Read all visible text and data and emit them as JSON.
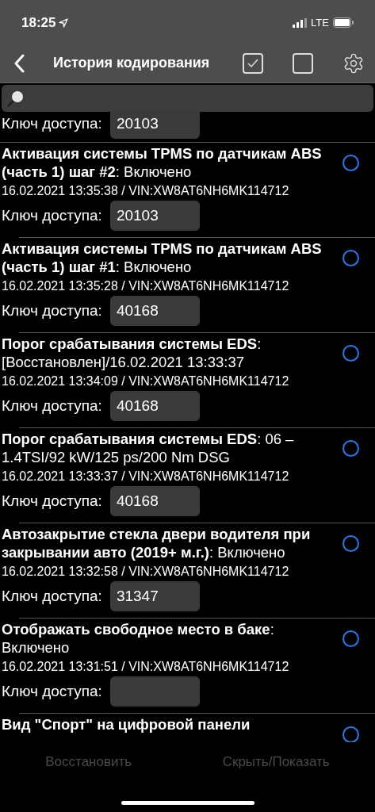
{
  "status_bar": {
    "time": "18:25",
    "network": "LTE"
  },
  "nav": {
    "title": "История кодирования"
  },
  "entries": [
    {
      "kind": "key_only",
      "key_label": "Ключ доступа:",
      "key": "20103"
    },
    {
      "kind": "full",
      "title": "**Активация системы TPMS по датчикам ABS (часть 1) шаг #2**: Включено",
      "meta": "16.02.2021 13:35:38 / VIN:XW8AT6NH6MK114712",
      "key_label": "Ключ доступа:",
      "key": "20103",
      "selected": false
    },
    {
      "kind": "full",
      "title": "**Активация системы TPMS по датчикам ABS (часть 1) шаг #1**: Включено",
      "meta": "16.02.2021 13:35:28 / VIN:XW8AT6NH6MK114712",
      "key_label": "Ключ доступа:",
      "key": "40168",
      "selected": false
    },
    {
      "kind": "full",
      "title": "**Порог срабатывания системы EDS**: [Восстановлен]/16.02.2021 13:33:37",
      "meta": "16.02.2021 13:34:09 / VIN:XW8AT6NH6MK114712",
      "key_label": "Ключ доступа:",
      "key": "40168",
      "selected": false
    },
    {
      "kind": "full",
      "title": "**Порог срабатывания системы EDS**: 06 – 1.4TSI/92 kW/125 ps/200 Nm DSG",
      "meta": "16.02.2021 13:33:37 / VIN:XW8AT6NH6MK114712",
      "key_label": "Ключ доступа:",
      "key": "40168",
      "selected": false
    },
    {
      "kind": "full",
      "title": "**Автозакрытие стекла двери водителя при закрывании авто (2019+ м.г.)**: Включено",
      "meta": "16.02.2021 13:32:58 / VIN:XW8AT6NH6MK114712",
      "key_label": "Ключ доступа:",
      "key": "31347",
      "selected": false
    },
    {
      "kind": "full",
      "title": "**Отображать свободное место в баке**: Включено",
      "meta": "16.02.2021 13:31:51 / VIN:XW8AT6NH6MK114712",
      "key_label": "Ключ доступа:",
      "selected": false
    },
    {
      "kind": "title_only",
      "title": "**Вид \"Спорт\" на цифровой панели**",
      "selected": false
    }
  ],
  "toolbar": [
    {
      "label": "Восстановить",
      "disabled": true
    },
    {
      "label": "Скрыть/Показать",
      "disabled": true
    }
  ]
}
